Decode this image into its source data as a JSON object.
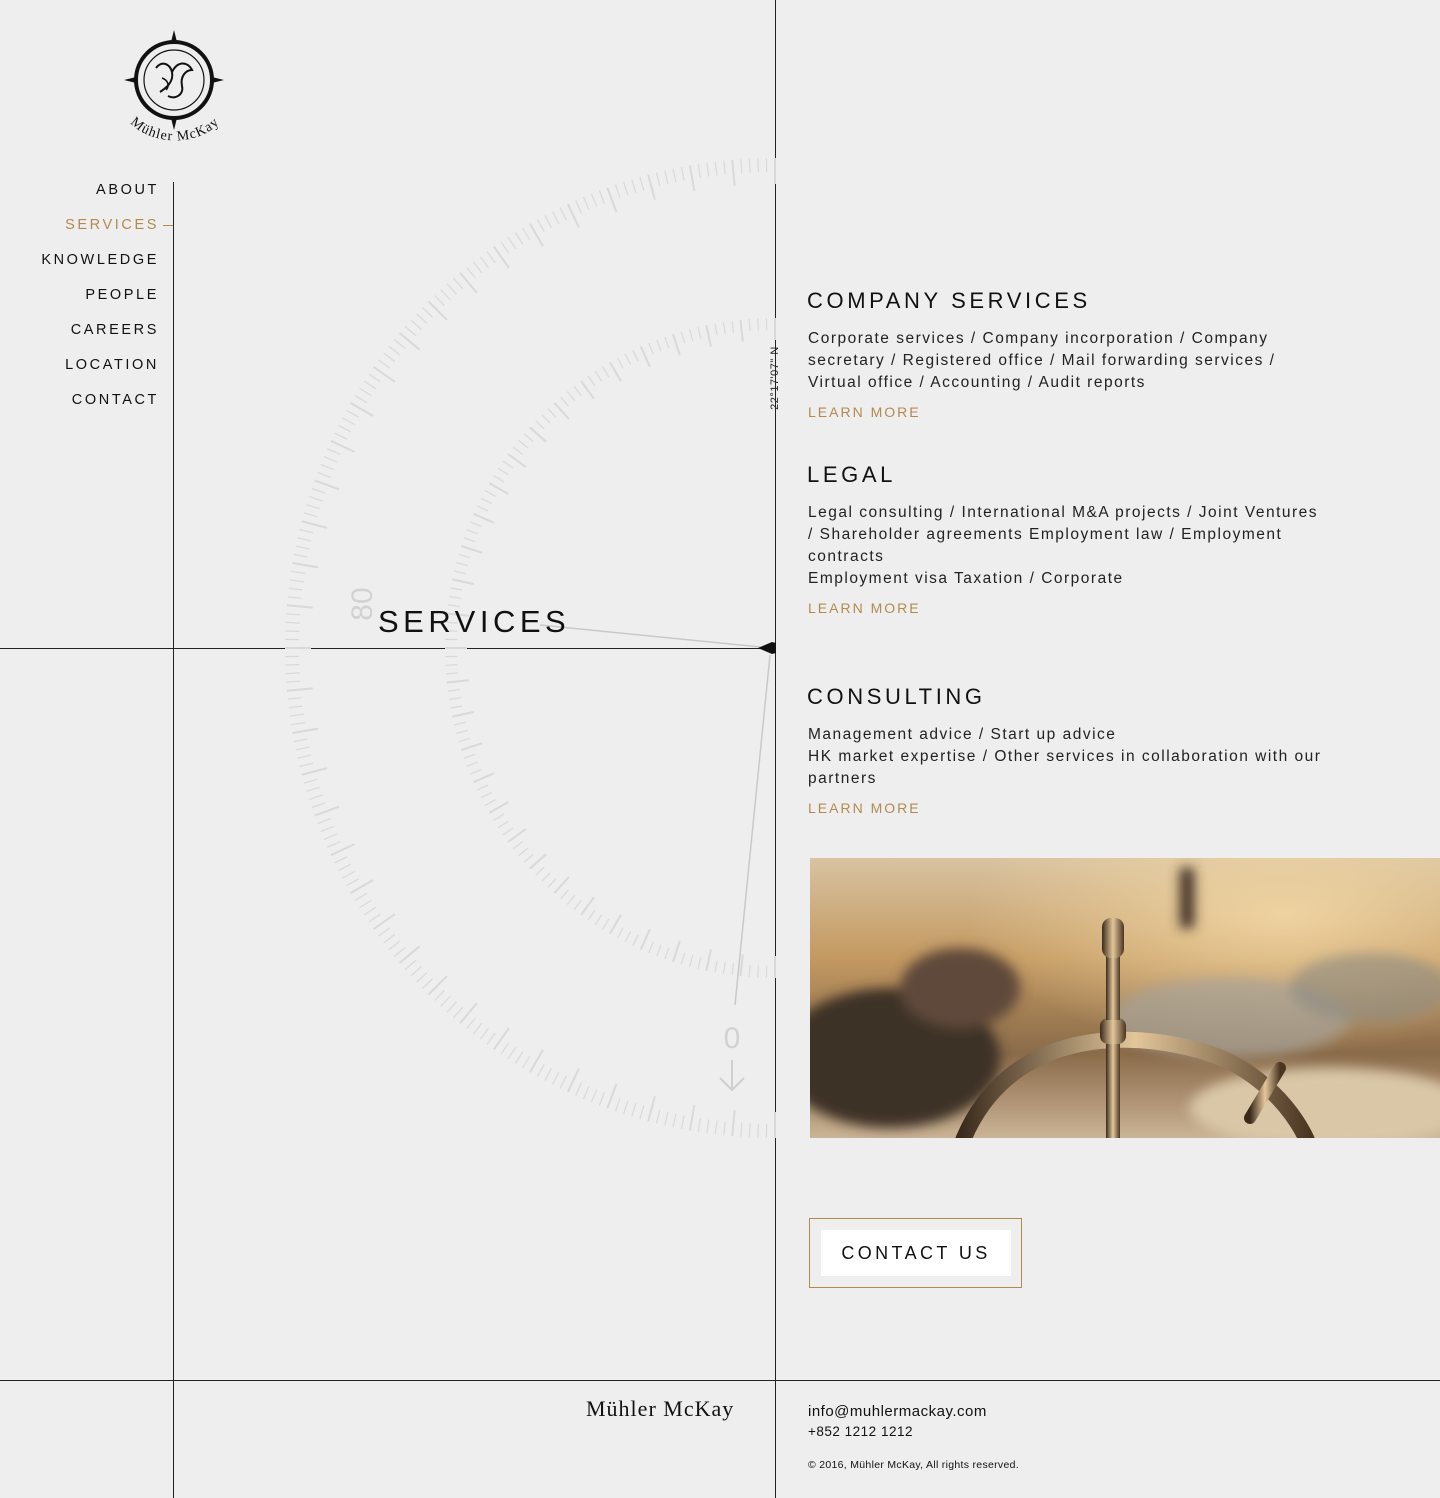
{
  "brand": {
    "logo_text": "Mühler McKay",
    "footer_name": "Mühler McKay"
  },
  "nav": {
    "items": [
      {
        "label": "ABOUT",
        "active": false
      },
      {
        "label": "SERVICES",
        "active": true
      },
      {
        "label": "KNOWLEDGE",
        "active": false
      },
      {
        "label": "PEOPLE",
        "active": false
      },
      {
        "label": "CAREERS",
        "active": false
      },
      {
        "label": "LOCATION",
        "active": false
      },
      {
        "label": "CONTACT",
        "active": false
      }
    ]
  },
  "hero": {
    "title": "SERVICES",
    "coordinate": "22°17'07\" N",
    "dial_labels": [
      "80",
      "0"
    ]
  },
  "sections": [
    {
      "heading": "COMPANY SERVICES",
      "lines": [
        "Corporate services / Company incorporation / Company secretary / Registered office / Mail forwarding services / Virtual office / Accounting / Audit reports"
      ],
      "link": "LEARN MORE"
    },
    {
      "heading": "LEGAL",
      "lines": [
        "Legal consulting / International M&A projects / Joint Ventures / Shareholder agreements Employment law / Employment contracts",
        "Employment visa Taxation / Corporate"
      ],
      "link": "LEARN MORE"
    },
    {
      "heading": "CONSULTING",
      "lines": [
        "Management advice / Start up advice",
        "HK market expertise / Other services in collaboration with our partners"
      ],
      "link": "LEARN MORE"
    }
  ],
  "cta": {
    "label": "CONTACT US"
  },
  "footer": {
    "email": "info@muhlermackay.com",
    "phone": "+852 1212 1212",
    "copyright": "© 2016, Mühler McKay, All rights reserved."
  },
  "colors": {
    "background": "#eeeeee",
    "accent": "#b38a4e",
    "text": "#111111",
    "rule": "#222222"
  }
}
